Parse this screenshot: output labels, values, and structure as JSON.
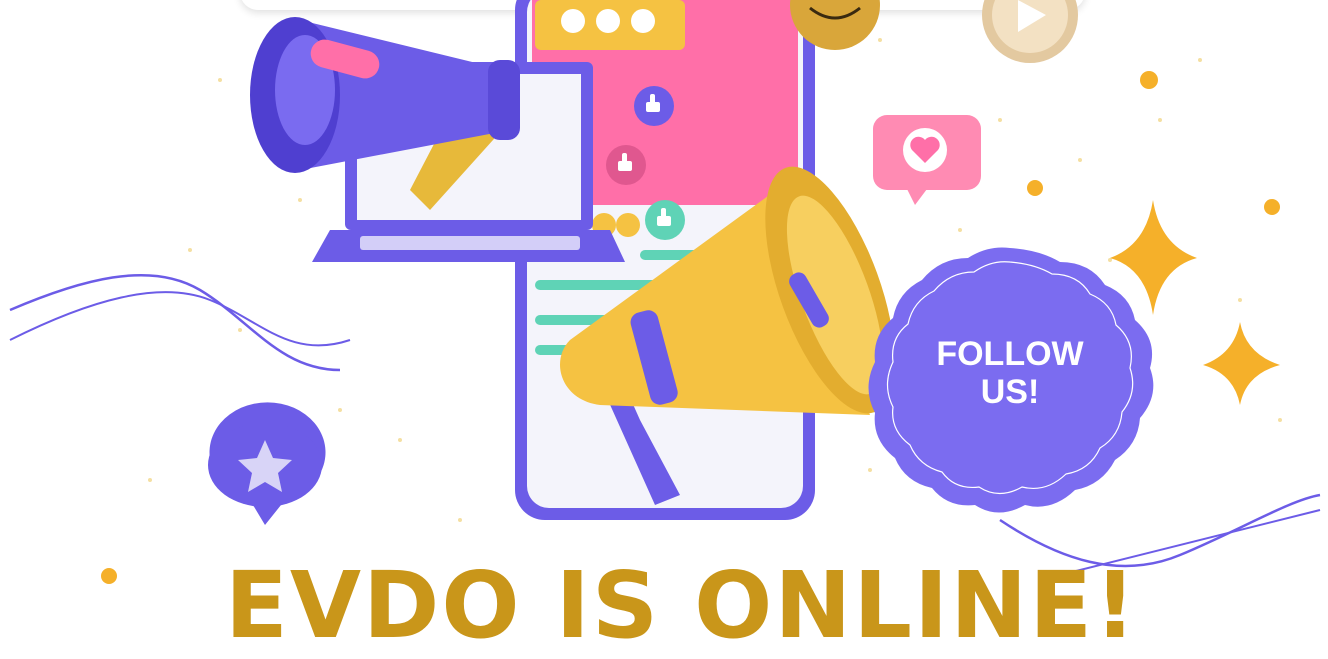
{
  "badge": {
    "line1": "FOLLOW",
    "line2": "US!"
  },
  "headline": "EVDO IS ONLINE!",
  "colors": {
    "purple": "#6c5ce7",
    "yellow": "#f5c242",
    "pink": "#ff6fa8",
    "teal": "#5fd3b6",
    "gold_text": "#c9961a"
  }
}
